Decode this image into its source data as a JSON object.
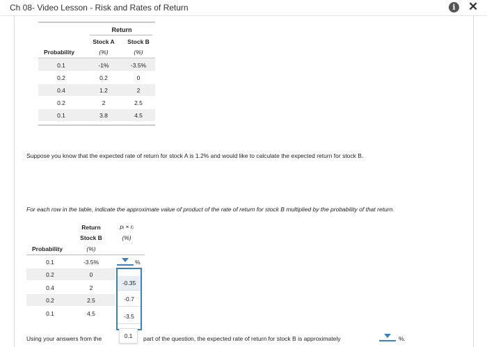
{
  "window": {
    "title": "Ch 08- Video Lesson - Risk and Rates of Return"
  },
  "icons": {
    "info": "info-icon",
    "close": "close-icon",
    "dropdown_arrow": "chevron-down-icon"
  },
  "table1": {
    "group_header": "Return",
    "col_prob": "Probability",
    "col_a": "Stock A",
    "col_a_unit": "(%)",
    "col_b": "Stock B",
    "col_b_unit": "(%)",
    "rows": [
      {
        "p": "0.1",
        "a": "-1%",
        "b": "-3.5%"
      },
      {
        "p": "0.2",
        "a": "0.2",
        "b": "0"
      },
      {
        "p": "0.4",
        "a": "1.2",
        "b": "2"
      },
      {
        "p": "0.2",
        "a": "2",
        "b": "2.5"
      },
      {
        "p": "0.1",
        "a": "3.8",
        "b": "4.5"
      }
    ]
  },
  "text": {
    "suppose": "Suppose you know that the expected rate of return for stock A is 1.2% and would like to calculate the expected return for stock B.",
    "instruction": "For each row in the table, indicate the approximate value of product of the rate of return for stock B multiplied by the probability of that return."
  },
  "table2": {
    "col_return": "Return",
    "col_stock_b": "Stock B",
    "col_unit": "(%)",
    "col_product": "pᵢ × rᵢ",
    "col_product_unit": "(%)",
    "col_prob": "Probability",
    "rows": [
      {
        "p": "0.1",
        "r": "-3.5%"
      },
      {
        "p": "0.2",
        "r": "0"
      },
      {
        "p": "0.4",
        "r": "2"
      },
      {
        "p": "0.2",
        "r": "2.5"
      },
      {
        "p": "0.1",
        "r": "4.5"
      }
    ],
    "percent": "%"
  },
  "dropdown_menu": {
    "options": [
      "-0.35",
      "-0.7",
      "-3.5",
      "0.1"
    ],
    "selected": "-0.35"
  },
  "bottom": {
    "prefix": "Using your answers from the",
    "suffix": "part of the question, the expected rate of return for stock B is approximately",
    "percent": "%."
  }
}
